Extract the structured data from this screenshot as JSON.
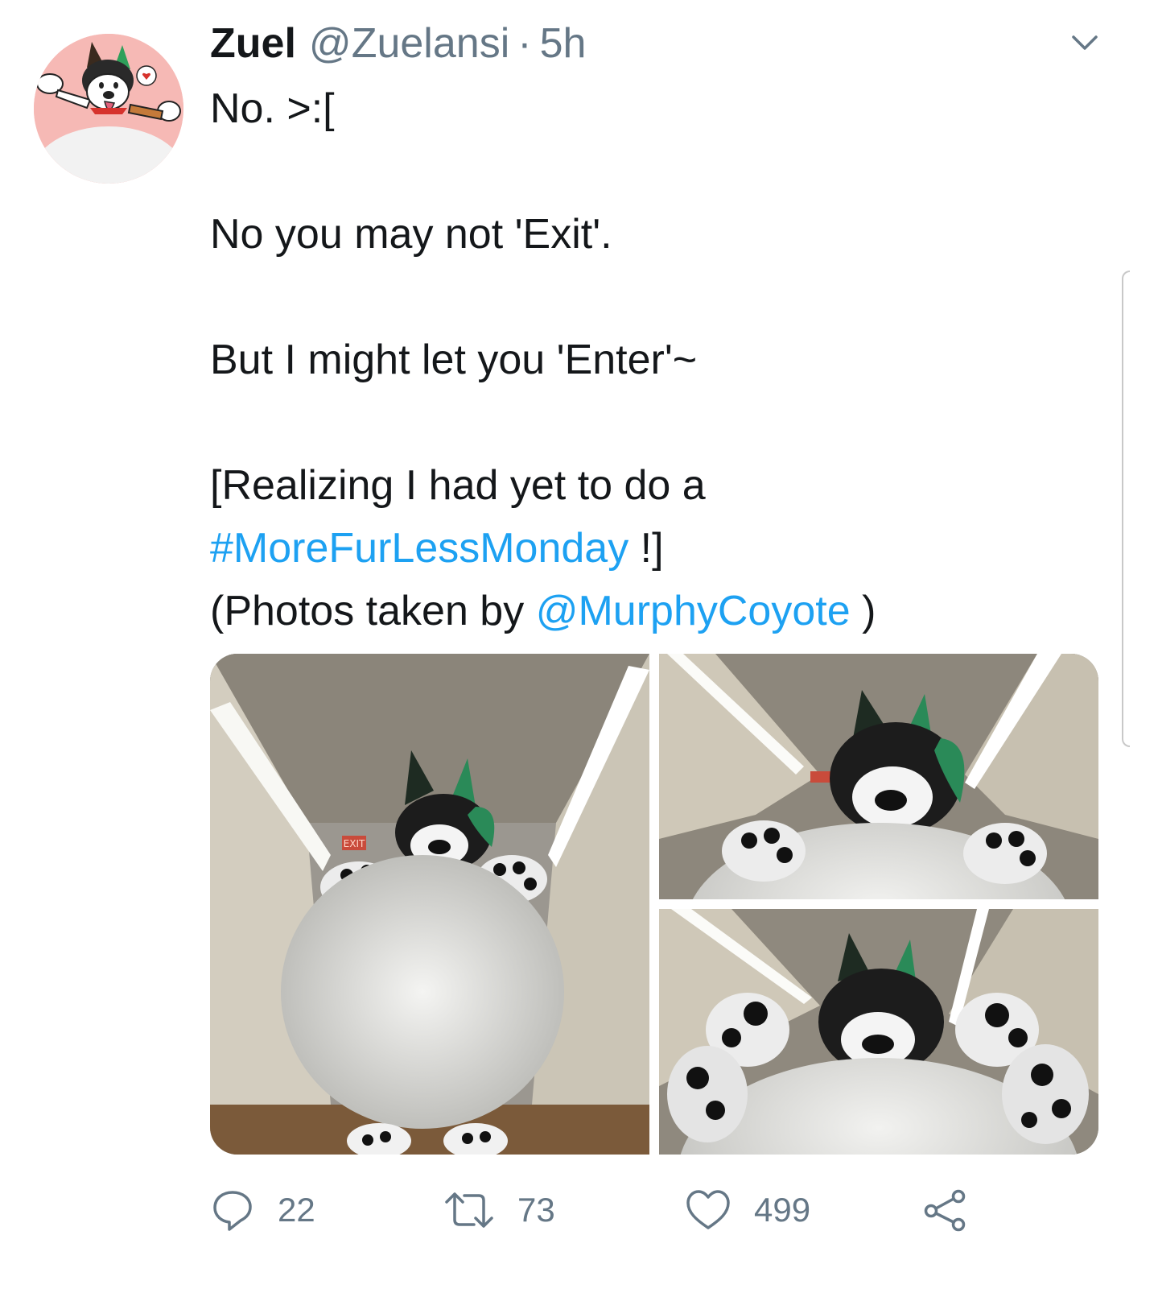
{
  "tweet": {
    "author_name": "Zuel",
    "author_handle": "@Zuelansi",
    "separator": "·",
    "time": "5h",
    "lines": {
      "l1": "No. >:[",
      "l2": "No you may not 'Exit'.",
      "l3": "But I might let you 'Enter'~",
      "l4": "[Realizing I had yet to do a",
      "l5_hashtag": "#MoreFurLessMonday",
      "l5_suffix": " !]",
      "l6_prefix": "(Photos taken by ",
      "l6_mention": "@MurphyCoyote",
      "l6_suffix": " )"
    },
    "photo_sign_text": "EXIT"
  },
  "actions": {
    "reply_count": "22",
    "retweet_count": "73",
    "like_count": "499"
  },
  "icons": {
    "more": "chevron-down-icon",
    "reply": "reply-icon",
    "retweet": "retweet-icon",
    "like": "heart-icon",
    "share": "share-icon"
  },
  "colors": {
    "text": "#14171a",
    "secondary": "#657786",
    "link": "#1da1f2"
  }
}
